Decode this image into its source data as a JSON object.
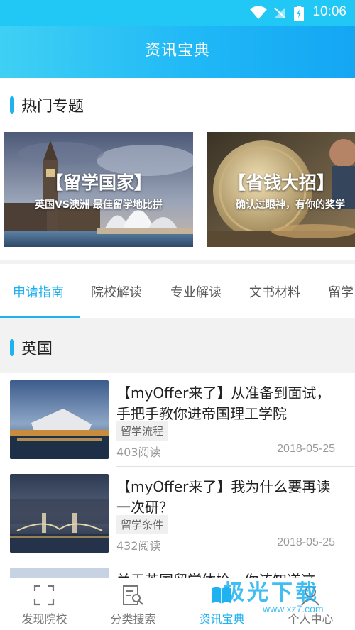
{
  "status_bar": {
    "time": "10:06",
    "icons": [
      "wifi-icon",
      "no-signal-icon",
      "battery-charging-icon"
    ]
  },
  "header": {
    "title": "资讯宝典"
  },
  "hot_topics": {
    "title": "热门专题",
    "banners": [
      {
        "title": "【留学国家】",
        "subtitle": "英国VS澳洲 最佳留学地比拼"
      },
      {
        "title": "【省钱大招】",
        "subtitle": "确认过眼神，有你的奖学"
      }
    ]
  },
  "tabs": [
    {
      "label": "申请指南",
      "active": true
    },
    {
      "label": "院校解读",
      "active": false
    },
    {
      "label": "专业解读",
      "active": false
    },
    {
      "label": "文书材料",
      "active": false
    },
    {
      "label": "留学",
      "active": false
    }
  ],
  "country_section": {
    "title": "英国"
  },
  "articles": [
    {
      "title": "【myOffer来了】从准备到面试，手把手教你进帝国理工学院",
      "tag": "留学流程",
      "reads": "403阅读",
      "date": "2018-05-25"
    },
    {
      "title": "【myOffer来了】我为什么要再读一次研？",
      "tag": "留学条件",
      "reads": "432阅读",
      "date": "2018-05-25"
    },
    {
      "title": "关于英国留学体检，你该知道这",
      "tag": "",
      "reads": "",
      "date": ""
    }
  ],
  "bottom_nav": [
    {
      "label": "发现院校",
      "icon": "scan-frame-icon",
      "active": false
    },
    {
      "label": "分类搜索",
      "icon": "search-list-icon",
      "active": false
    },
    {
      "label": "资讯宝典",
      "icon": "book-icon",
      "active": true
    },
    {
      "label": "个人中心",
      "icon": "user-icon",
      "active": false
    }
  ],
  "watermark": {
    "text": "极光下载",
    "url": "www.xz7.com"
  },
  "colors": {
    "accent": "#1fb2f0",
    "header_start": "#3fd0f4",
    "header_end": "#14a6f3"
  }
}
